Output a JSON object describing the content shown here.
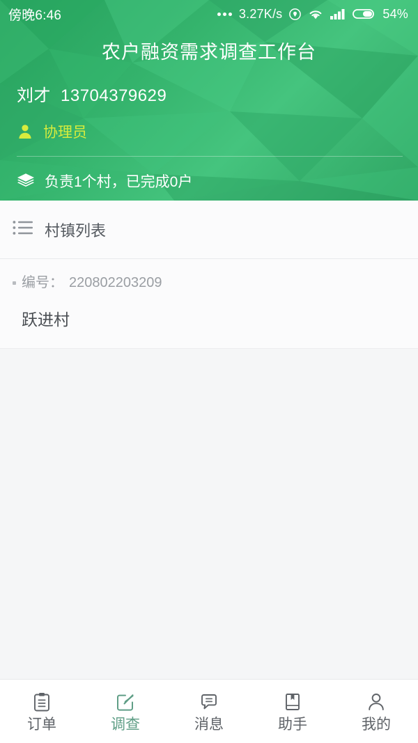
{
  "statusbar": {
    "clock": "傍晚6:46",
    "overflow_dots": "•••",
    "network_speed": "3.27K/s",
    "icons": [
      "more-dots-icon",
      "location-icon",
      "wifi-icon",
      "signal-icon",
      "battery-icon"
    ],
    "battery_percent": "54%"
  },
  "header": {
    "title": "农户融资需求调查工作台",
    "user_name": "刘才",
    "user_phone": "13704379629",
    "role_label": "协理员",
    "role_icon": "person-icon",
    "summary_text": "负责1个村，已完成0户",
    "summary_icon": "layers-icon",
    "bg_color_dark": "#25a05c",
    "bg_color_light": "#45c47e",
    "role_color": "#d7ec3d"
  },
  "card": {
    "list_icon": "list-icon",
    "list_title": "村镇列表",
    "villages": [
      {
        "code_label": "编号：",
        "code_value": "220802203209",
        "name": "跃进村"
      }
    ]
  },
  "tabbar": {
    "active_color": "#5f9e86",
    "inactive_color": "#5f6368",
    "tabs": [
      {
        "label": "订单",
        "icon": "clipboard-icon",
        "active": false
      },
      {
        "label": "调查",
        "icon": "edit-square-icon",
        "active": true
      },
      {
        "label": "消息",
        "icon": "chat-bubble-icon",
        "active": false
      },
      {
        "label": "助手",
        "icon": "book-icon",
        "active": false
      },
      {
        "label": "我的",
        "icon": "person-outline-icon",
        "active": false
      }
    ]
  }
}
